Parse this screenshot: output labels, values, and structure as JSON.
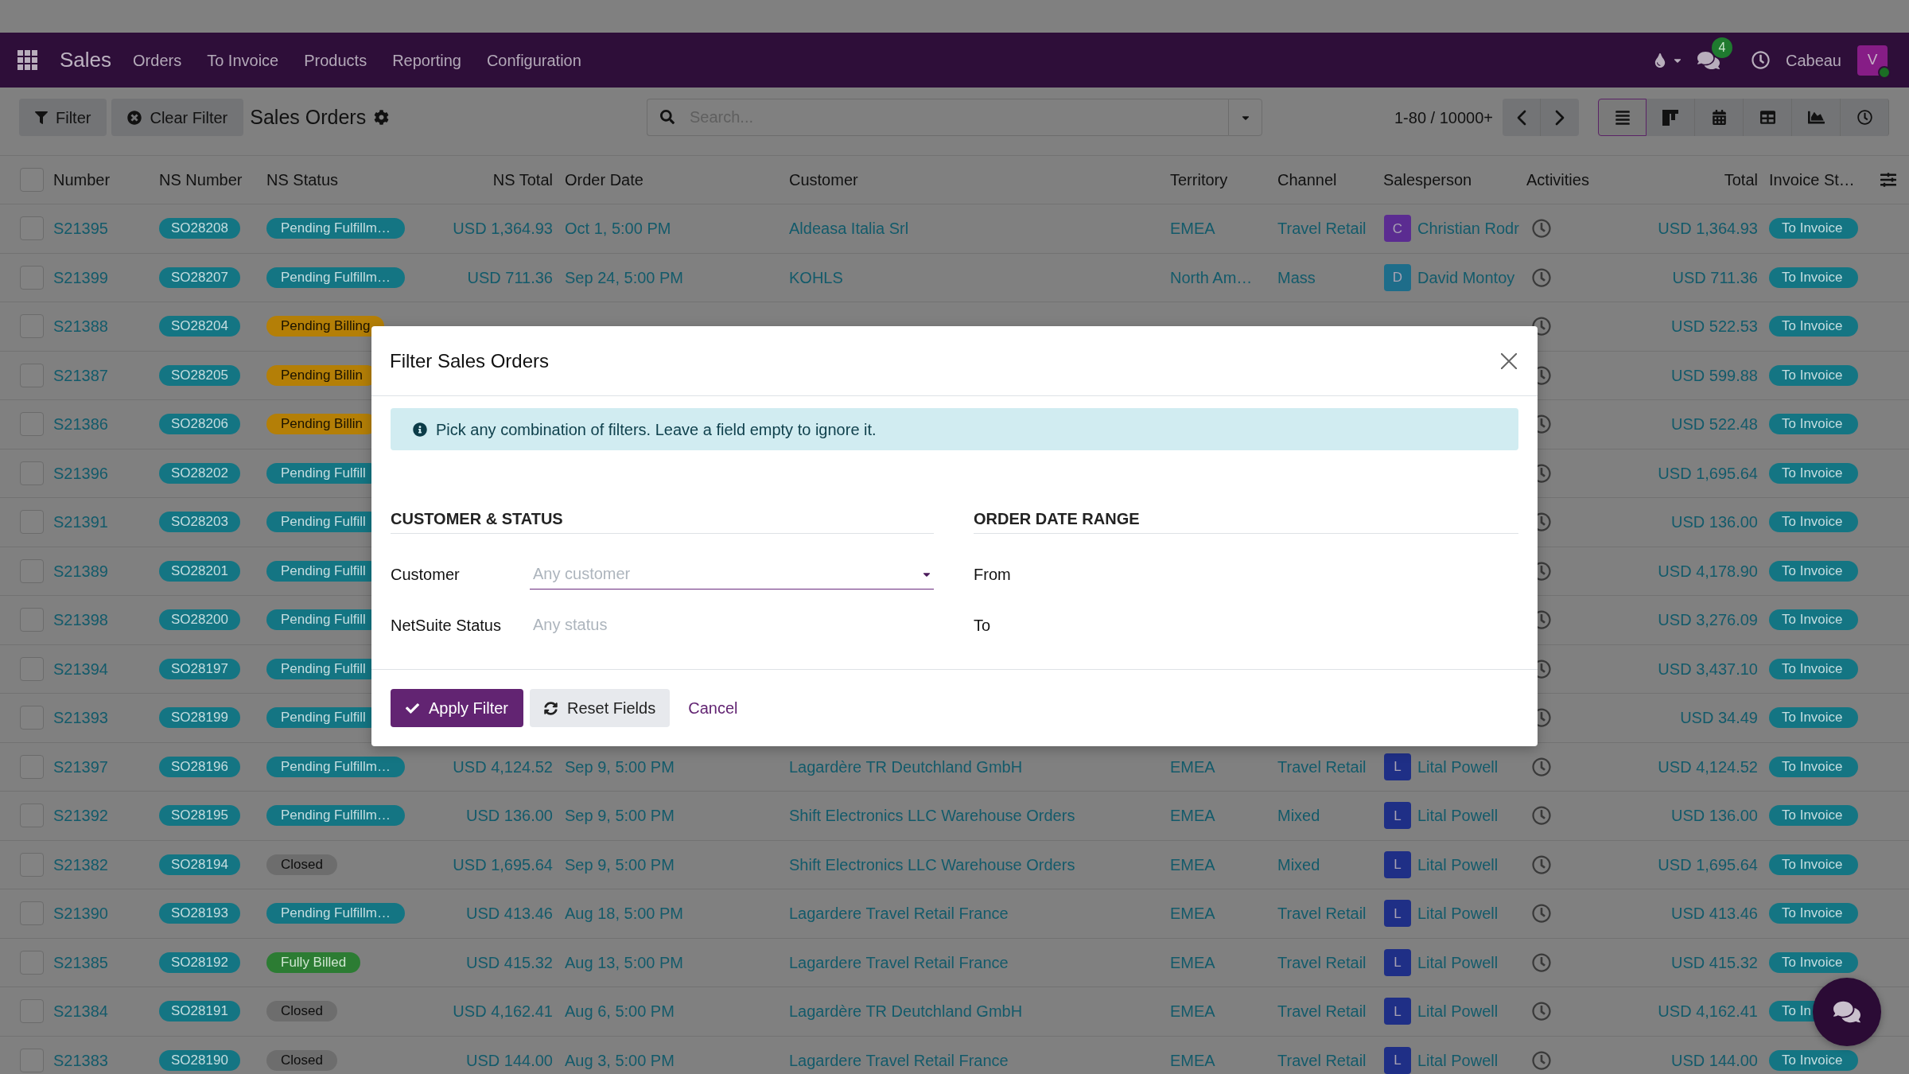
{
  "navbar": {
    "app_name": "Sales",
    "menu": [
      "Orders",
      "To Invoice",
      "Products",
      "Reporting",
      "Configuration"
    ],
    "message_count": "4",
    "company": "Cabeau",
    "user_initial": "V",
    "user_online": true
  },
  "control_panel": {
    "buttons": [
      {
        "label": "Filter",
        "kind": "filter"
      },
      {
        "label": "Clear Filter",
        "kind": "clear"
      }
    ],
    "title": "Sales Orders",
    "search": {
      "placeholder": "Search..."
    },
    "pager": "1-80 / 10000+",
    "views": [
      {
        "kind": "list",
        "selected": true
      },
      {
        "kind": "kanban",
        "selected": false
      },
      {
        "kind": "calendar",
        "selected": false
      },
      {
        "kind": "pivot",
        "selected": false
      },
      {
        "kind": "graph",
        "selected": false
      },
      {
        "kind": "activity",
        "selected": false
      }
    ]
  },
  "table": {
    "select_all": false,
    "columns": [
      "Number",
      "NS Number",
      "NS Status",
      "NS Total",
      "Order Date",
      "Customer",
      "Territory",
      "Channel",
      "Salesperson",
      "Activities",
      "Total",
      "Invoice St…"
    ],
    "rows": [
      {
        "selected": false,
        "number": "S21395",
        "ns_number": "SO28208",
        "ns_status": {
          "label": "Pending Fulfillm…",
          "kind": "fulfillment"
        },
        "ns_total": "USD 1,364.93",
        "order_date": "Oct 1, 5:00 PM",
        "customer": "Aldeasa Italia Srl",
        "territory": "EMEA",
        "channel": "Travel Retail",
        "salesperson": {
          "initial": "C",
          "name": "Christian Rodr",
          "color": "#5b2c91"
        },
        "total": "USD 1,364.93",
        "invoice_status": "To Invoice"
      },
      {
        "selected": false,
        "number": "S21399",
        "ns_number": "SO28207",
        "ns_status": {
          "label": "Pending Fulfillm…",
          "kind": "fulfillment"
        },
        "ns_total": "USD 711.36",
        "order_date": "Sep 24, 5:00 PM",
        "customer": "KOHLS",
        "territory": "North Am…",
        "channel": "Mass",
        "salesperson": {
          "initial": "D",
          "name": "David Montoy",
          "color": "#1e6d8a"
        },
        "total": "USD 711.36",
        "invoice_status": "To Invoice"
      },
      {
        "selected": false,
        "number": "S21388",
        "ns_number": "SO28204",
        "ns_status": {
          "label": "Pending Billing",
          "kind": "billing"
        },
        "total": "USD 522.53",
        "invoice_status": "To Invoice"
      },
      {
        "selected": false,
        "number": "S21387",
        "ns_number": "SO28205",
        "ns_status": {
          "label": "Pending Billin",
          "kind": "billing"
        },
        "total": "USD 599.88",
        "invoice_status": "To Invoice"
      },
      {
        "selected": false,
        "number": "S21386",
        "ns_number": "SO28206",
        "ns_status": {
          "label": "Pending Billin",
          "kind": "billing"
        },
        "total": "USD 522.48",
        "invoice_status": "To Invoice"
      },
      {
        "selected": false,
        "number": "S21396",
        "ns_number": "SO28202",
        "ns_status": {
          "label": "Pending Fulfill",
          "kind": "fulfillment"
        },
        "total": "USD 1,695.64",
        "invoice_status": "To Invoice"
      },
      {
        "selected": false,
        "number": "S21391",
        "ns_number": "SO28203",
        "ns_status": {
          "label": "Pending Fulfill",
          "kind": "fulfillment"
        },
        "total": "USD 136.00",
        "invoice_status": "To Invoice"
      },
      {
        "selected": false,
        "number": "S21389",
        "ns_number": "SO28201",
        "ns_status": {
          "label": "Pending Fulfill",
          "kind": "fulfillment"
        },
        "total": "USD 4,178.90",
        "invoice_status": "To Invoice"
      },
      {
        "selected": false,
        "number": "S21398",
        "ns_number": "SO28200",
        "ns_status": {
          "label": "Pending Fulfill",
          "kind": "fulfillment"
        },
        "total": "USD 3,276.09",
        "invoice_status": "To Invoice"
      },
      {
        "selected": false,
        "number": "S21394",
        "ns_number": "SO28197",
        "ns_status": {
          "label": "Pending Fulfill",
          "kind": "fulfillment"
        },
        "total": "USD 3,437.10",
        "invoice_status": "To Invoice"
      },
      {
        "selected": false,
        "number": "S21393",
        "ns_number": "SO28199",
        "ns_status": {
          "label": "Pending Fulfill",
          "kind": "fulfillment"
        },
        "total": "USD 34.49",
        "invoice_status": "To Invoice"
      },
      {
        "selected": false,
        "number": "S21397",
        "ns_number": "SO28196",
        "ns_status": {
          "label": "Pending Fulfillm…",
          "kind": "fulfillment"
        },
        "ns_total": "USD 4,124.52",
        "order_date": "Sep 9, 5:00 PM",
        "customer": "Lagardère TR Deutchland GmbH",
        "territory": "EMEA",
        "channel": "Travel Retail",
        "salesperson": {
          "initial": "L",
          "name": "Lital Powell",
          "color": "#1f2f86"
        },
        "total": "USD 4,124.52",
        "invoice_status": "To Invoice"
      },
      {
        "selected": false,
        "number": "S21392",
        "ns_number": "SO28195",
        "ns_status": {
          "label": "Pending Fulfillm…",
          "kind": "fulfillment"
        },
        "ns_total": "USD 136.00",
        "order_date": "Sep 9, 5:00 PM",
        "customer": "Shift Electronics LLC Warehouse Orders",
        "territory": "EMEA",
        "channel": "Mixed",
        "salesperson": {
          "initial": "L",
          "name": "Lital Powell",
          "color": "#1f2f86"
        },
        "total": "USD 136.00",
        "invoice_status": "To Invoice"
      },
      {
        "selected": false,
        "number": "S21382",
        "ns_number": "SO28194",
        "ns_status": {
          "label": "Closed",
          "kind": "closed"
        },
        "ns_total": "USD 1,695.64",
        "order_date": "Sep 9, 5:00 PM",
        "customer": "Shift Electronics LLC Warehouse Orders",
        "territory": "EMEA",
        "channel": "Mixed",
        "salesperson": {
          "initial": "L",
          "name": "Lital Powell",
          "color": "#1f2f86"
        },
        "total": "USD 1,695.64",
        "invoice_status": "To Invoice"
      },
      {
        "selected": false,
        "number": "S21390",
        "ns_number": "SO28193",
        "ns_status": {
          "label": "Pending Fulfillm…",
          "kind": "fulfillment"
        },
        "ns_total": "USD 413.46",
        "order_date": "Aug 18, 5:00 PM",
        "customer": "Lagardere Travel Retail France",
        "territory": "EMEA",
        "channel": "Travel Retail",
        "salesperson": {
          "initial": "L",
          "name": "Lital Powell",
          "color": "#1f2f86"
        },
        "total": "USD 413.46",
        "invoice_status": "To Invoice"
      },
      {
        "selected": false,
        "number": "S21385",
        "ns_number": "SO28192",
        "ns_status": {
          "label": "Fully Billed",
          "kind": "billed"
        },
        "ns_total": "USD 415.32",
        "order_date": "Aug 13, 5:00 PM",
        "customer": "Lagardere Travel Retail France",
        "territory": "EMEA",
        "channel": "Travel Retail",
        "salesperson": {
          "initial": "L",
          "name": "Lital Powell",
          "color": "#1f2f86"
        },
        "total": "USD 415.32",
        "invoice_status": "To Invoice"
      },
      {
        "selected": false,
        "number": "S21384",
        "ns_number": "SO28191",
        "ns_status": {
          "label": "Closed",
          "kind": "closed"
        },
        "ns_total": "USD 4,162.41",
        "order_date": "Aug 6, 5:00 PM",
        "customer": "Lagardère TR Deutchland GmbH",
        "territory": "EMEA",
        "channel": "Travel Retail",
        "salesperson": {
          "initial": "L",
          "name": "Lital Powell",
          "color": "#1f2f86"
        },
        "total": "USD 4,162.41",
        "invoice_status": "To In"
      },
      {
        "selected": false,
        "number": "S21383",
        "ns_number": "SO28190",
        "ns_status": {
          "label": "Closed",
          "kind": "closed"
        },
        "ns_total": "USD 144.00",
        "order_date": "Aug 3, 5:00 PM",
        "customer": "Lagardere Travel Retail France",
        "territory": "EMEA",
        "channel": "Travel Retail",
        "salesperson": {
          "initial": "L",
          "name": "Lital Powell",
          "color": "#1f2f86"
        },
        "total": "USD 144.00",
        "invoice_status": "To Invoice"
      }
    ]
  },
  "dialog": {
    "title": "Filter Sales Orders",
    "info": "Pick any combination of filters. Leave a field empty to ignore it.",
    "sections": [
      {
        "title": "CUSTOMER & STATUS",
        "fields": [
          {
            "label": "Customer",
            "kind": "select",
            "placeholder": "Any customer",
            "focused": true
          },
          {
            "label": "NetSuite Status",
            "kind": "text",
            "placeholder": "Any status",
            "focused": false
          }
        ]
      },
      {
        "title": "ORDER DATE RANGE",
        "fields": [
          {
            "label": "From",
            "kind": "date"
          },
          {
            "label": "To",
            "kind": "date"
          }
        ]
      }
    ],
    "buttons": [
      {
        "label": "Apply Filter",
        "kind": "primary"
      },
      {
        "label": "Reset Fields",
        "kind": "secondary"
      },
      {
        "label": "Cancel",
        "kind": "link"
      }
    ]
  }
}
